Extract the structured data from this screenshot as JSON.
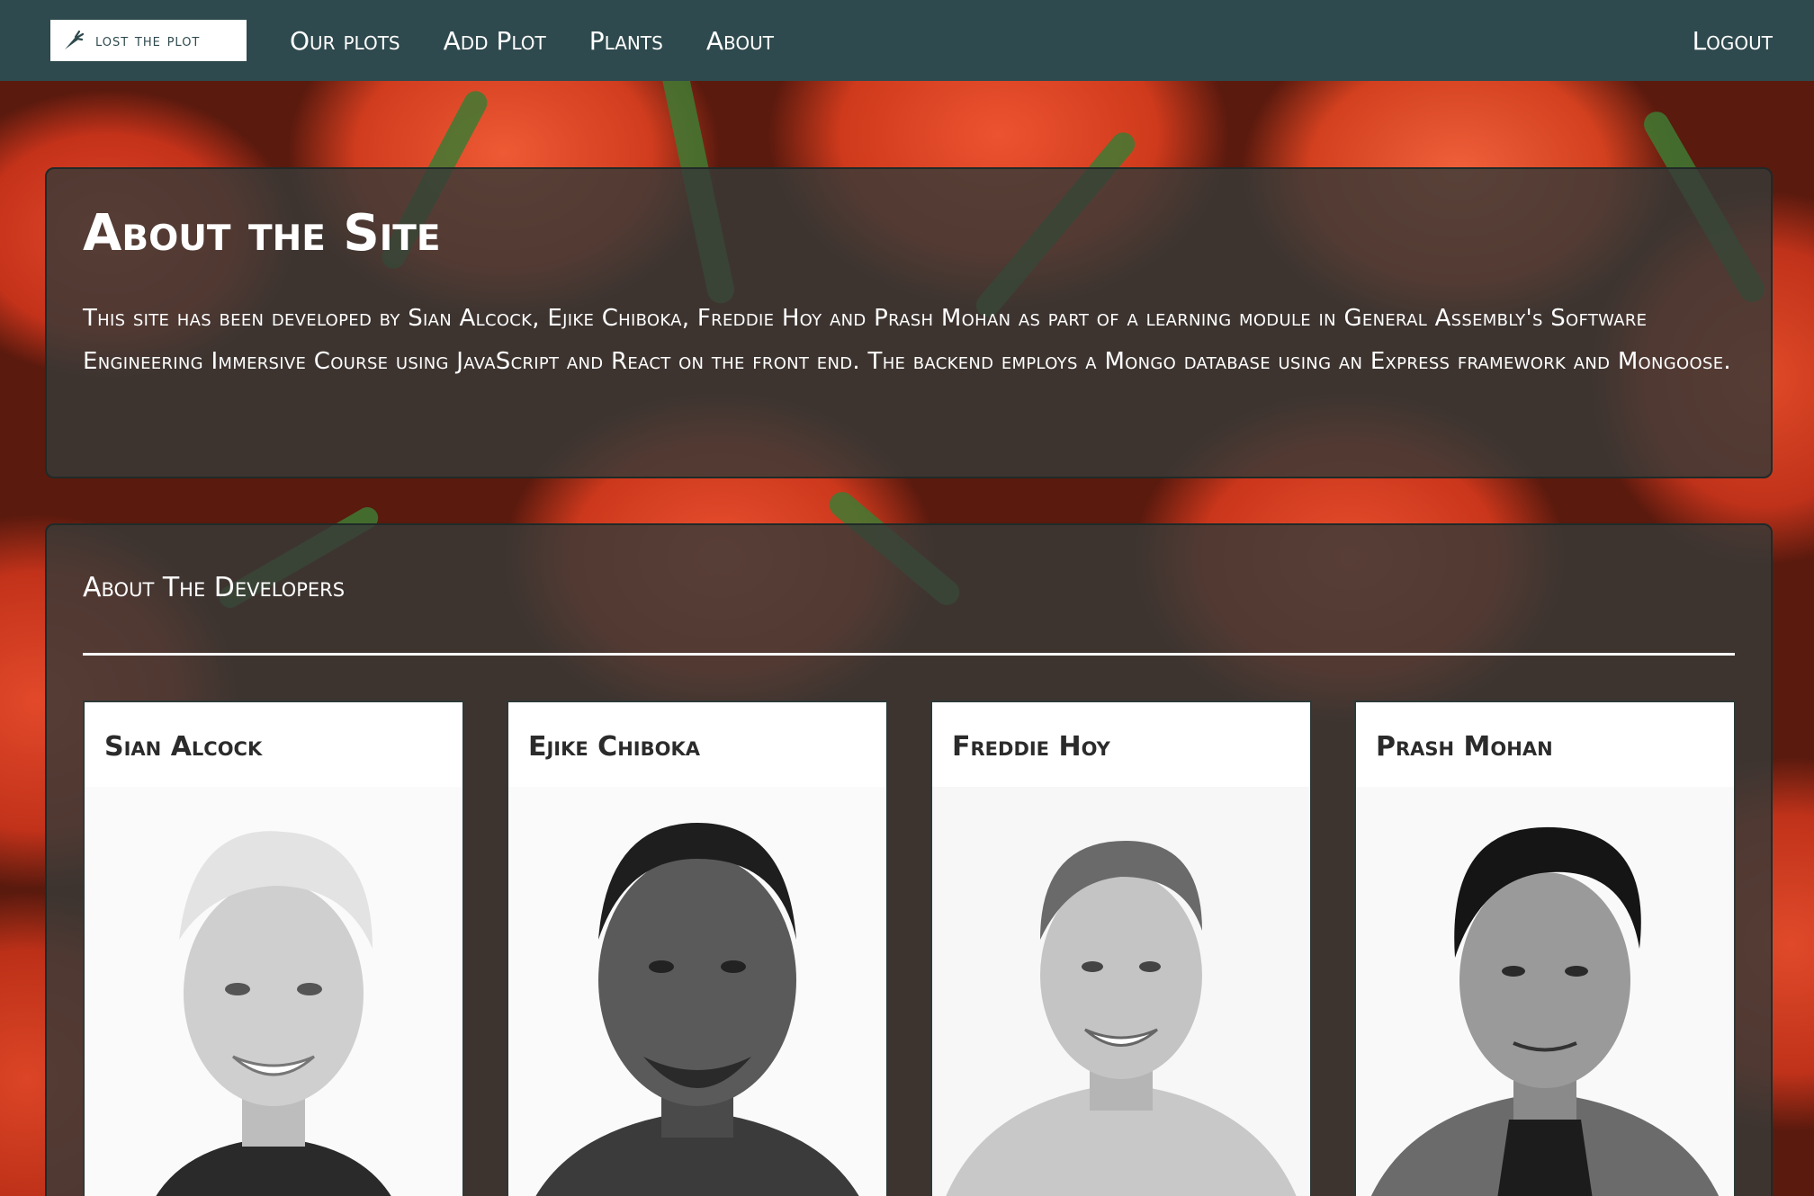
{
  "navbar": {
    "brand_label": "lost the plot",
    "brand_icon": "carrot-icon",
    "items": [
      {
        "label": "Our plots"
      },
      {
        "label": "Add Plot"
      },
      {
        "label": "Plants"
      },
      {
        "label": "About"
      }
    ],
    "logout_label": "Logout"
  },
  "about_site": {
    "title": "About the Site",
    "text": "This site has been developed by Sian Alcock, Ejike Chiboka, Freddie Hoy and Prash Mohan as part of a learning module in General Assembly's Software Engineering Immersive Course using JavaScript and React on the front end. The backend employs a Mongo database using an Express framework and Mongoose."
  },
  "about_developers": {
    "title": "About The Developers",
    "developers": [
      {
        "name": "Sian Alcock"
      },
      {
        "name": "Ejike Chiboka"
      },
      {
        "name": "Freddie Hoy"
      },
      {
        "name": "Prash Mohan"
      }
    ]
  },
  "colors": {
    "navbar": "#2f4a4e",
    "panel": "#373a38",
    "text_light": "#ffffff",
    "card_text": "#2b2b2b"
  }
}
